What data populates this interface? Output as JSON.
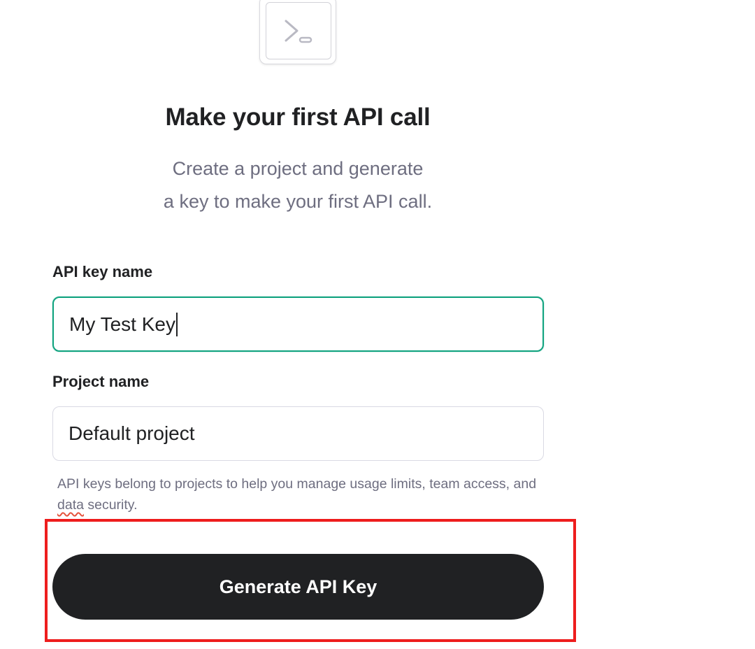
{
  "hero": {
    "icon": "terminal-prompt-icon",
    "title": "Make your first API call",
    "subtitle_line1": "Create a project and generate",
    "subtitle_line2": "a key to make your first API call."
  },
  "form": {
    "api_key_label": "API key name",
    "api_key_value": "My Test Key",
    "project_label": "Project name",
    "project_value": "Default project",
    "helper_text_before": "API keys belong to projects to help you manage usage limits, team access, and ",
    "helper_text_flagged": "data",
    "helper_text_after": " security."
  },
  "actions": {
    "generate_label": "Generate API Key"
  },
  "colors": {
    "accent_focus": "#10a37f",
    "button_bg": "#202123",
    "highlight_outline": "#ee1d1d",
    "muted_text": "#6e6e80"
  }
}
